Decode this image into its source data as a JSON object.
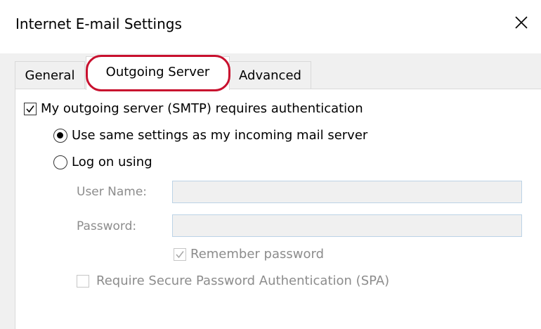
{
  "window": {
    "title": "Internet E-mail Settings",
    "close_glyph": "✕"
  },
  "tabs": [
    {
      "label": "General",
      "active": false
    },
    {
      "label": "Outgoing Server",
      "active": true
    },
    {
      "label": "Advanced",
      "active": false
    }
  ],
  "outgoing": {
    "auth_checkbox": {
      "label": "My outgoing server (SMTP) requires authentication",
      "checked": true
    },
    "radio_same": {
      "label": "Use same settings as my incoming mail server",
      "selected": true
    },
    "radio_logon": {
      "label": "Log on using",
      "selected": false
    },
    "username": {
      "label": "User Name:",
      "value": ""
    },
    "password": {
      "label": "Password:",
      "value": ""
    },
    "remember": {
      "label": "Remember password",
      "checked": true,
      "disabled": true
    },
    "spa": {
      "label": "Require Secure Password Authentication (SPA)",
      "checked": false,
      "disabled": true
    }
  },
  "colors": {
    "highlight": "#c8102e",
    "disabled_text": "#8c8c8c",
    "field_border": "#bcd3e6"
  }
}
